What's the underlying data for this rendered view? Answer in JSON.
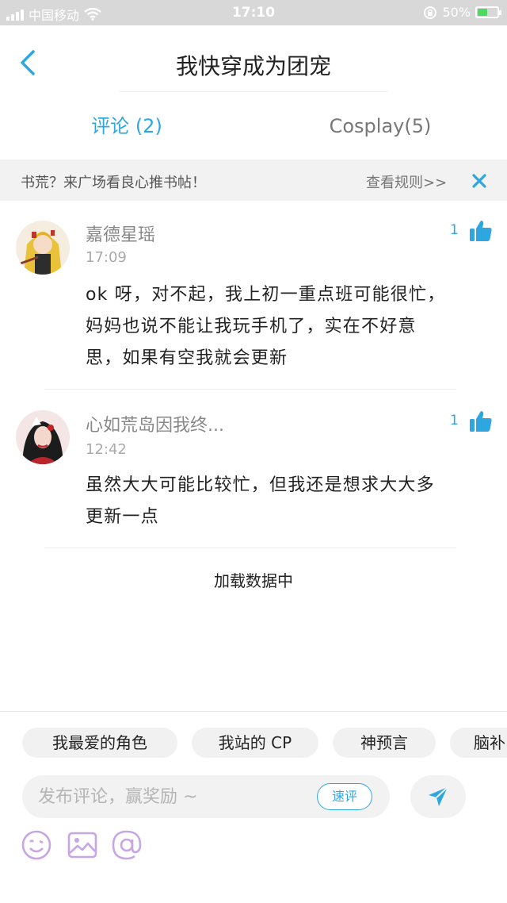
{
  "status_bar": {
    "carrier": "中国移动",
    "time": "17:10",
    "battery": "50%",
    "battery_level": 0.5
  },
  "nav": {
    "title": "我快穿成为团宠"
  },
  "tabs": [
    {
      "label": "评论 (2)",
      "active": true
    },
    {
      "label": "Cosplay(5)",
      "active": false
    }
  ],
  "notice": {
    "text": "书荒？来广场看良心推书帖！",
    "link": "查看规则>>"
  },
  "comments": [
    {
      "name": "嘉德星瑶",
      "time": "17:09",
      "likes": "1",
      "lines": [
        "ok 呀，对不起，我上初一重点班可能很忙，",
        "妈妈也说不能让我玩手机了，实在不好意",
        "思，如果有空我就会更新"
      ]
    },
    {
      "name": "心如荒岛因我终...",
      "time": "12:42",
      "likes": "1",
      "lines": [
        "虽然大大可能比较忙，但我还是想求大大多",
        "更新一点"
      ]
    }
  ],
  "loading": "加载数据中",
  "chips": [
    "我最爱的角色",
    "我站的 CP",
    "神预言",
    "脑补"
  ],
  "input": {
    "placeholder": "发布评论，赢奖励 ~",
    "quick_label": "速评"
  },
  "colors": {
    "accent": "#2ea7e0",
    "tool_icon": "#c7a6e6"
  }
}
